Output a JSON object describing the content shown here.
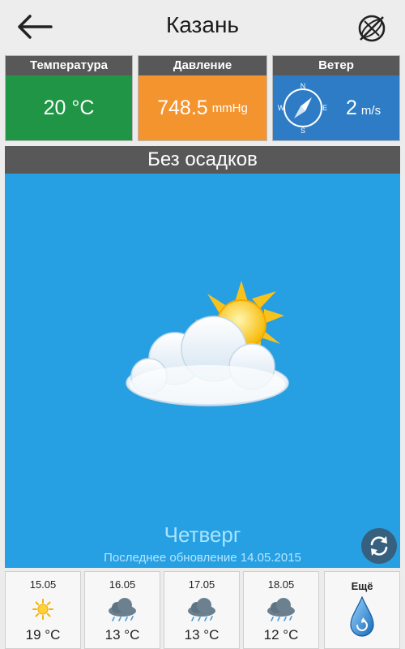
{
  "header": {
    "title": "Казань",
    "back_icon": "arrow-left-icon",
    "map_icon": "map-globe-icon"
  },
  "tiles": {
    "temperature": {
      "label": "Температура",
      "value": "20 °C",
      "color": "#1f9545"
    },
    "pressure": {
      "label": "Давление",
      "value": "748.5",
      "unit": "mmHg",
      "color": "#f3942f"
    },
    "wind": {
      "label": "Ветер",
      "value": "2",
      "unit": "m/s",
      "color": "#2d7cc5",
      "compass": {
        "n": "N",
        "e": "E",
        "s": "S",
        "w": "W"
      }
    }
  },
  "condition": "Без осадков",
  "main": {
    "background": "#26a0e2",
    "day": "Четверг",
    "updated": "Последнее обновление 14.05.2015",
    "weather_icon": "partly-cloudy-icon"
  },
  "forecast": [
    {
      "date": "15.05",
      "temp": "19 °C",
      "icon": "sun-icon"
    },
    {
      "date": "16.05",
      "temp": "13 °C",
      "icon": "rain-cloud-icon"
    },
    {
      "date": "17.05",
      "temp": "13 °C",
      "icon": "rain-cloud-icon"
    },
    {
      "date": "18.05",
      "temp": "12 °C",
      "icon": "rain-cloud-icon"
    }
  ],
  "more": {
    "label": "Ещё",
    "icon": "water-drop-icon"
  }
}
